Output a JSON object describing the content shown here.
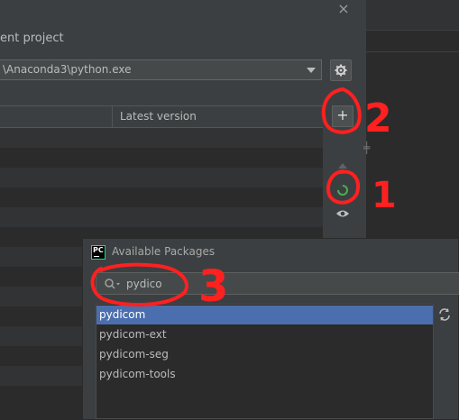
{
  "settings": {
    "project_label": "ent project",
    "interpreter_value": "\\Anaconda3\\python.exe",
    "table_header_latest": "Latest version",
    "close_glyph": "×"
  },
  "toolbar": {
    "add_glyph": "+"
  },
  "avail": {
    "title": "Available Packages",
    "logo_text": "PC",
    "search_value": "pydico",
    "results": [
      "pydicom",
      "pydicom-ext",
      "pydicom-seg",
      "pydicom-tools"
    ],
    "selected_index": 0
  },
  "annotations": {
    "color": "#ff2020",
    "labels": [
      "2",
      "1",
      "3"
    ]
  },
  "colors": {
    "selection": "#4b6eaf",
    "loading_ring": "#4caf50",
    "dialog_bg": "#3c3f41",
    "editor_bg": "#2b2b2b"
  },
  "icons": [
    "close-icon",
    "chevron-down-icon",
    "gear-icon",
    "add-icon",
    "move-up-icon",
    "loading-icon",
    "eye-icon",
    "pycharm-logo-icon",
    "search-icon",
    "refresh-icon"
  ]
}
